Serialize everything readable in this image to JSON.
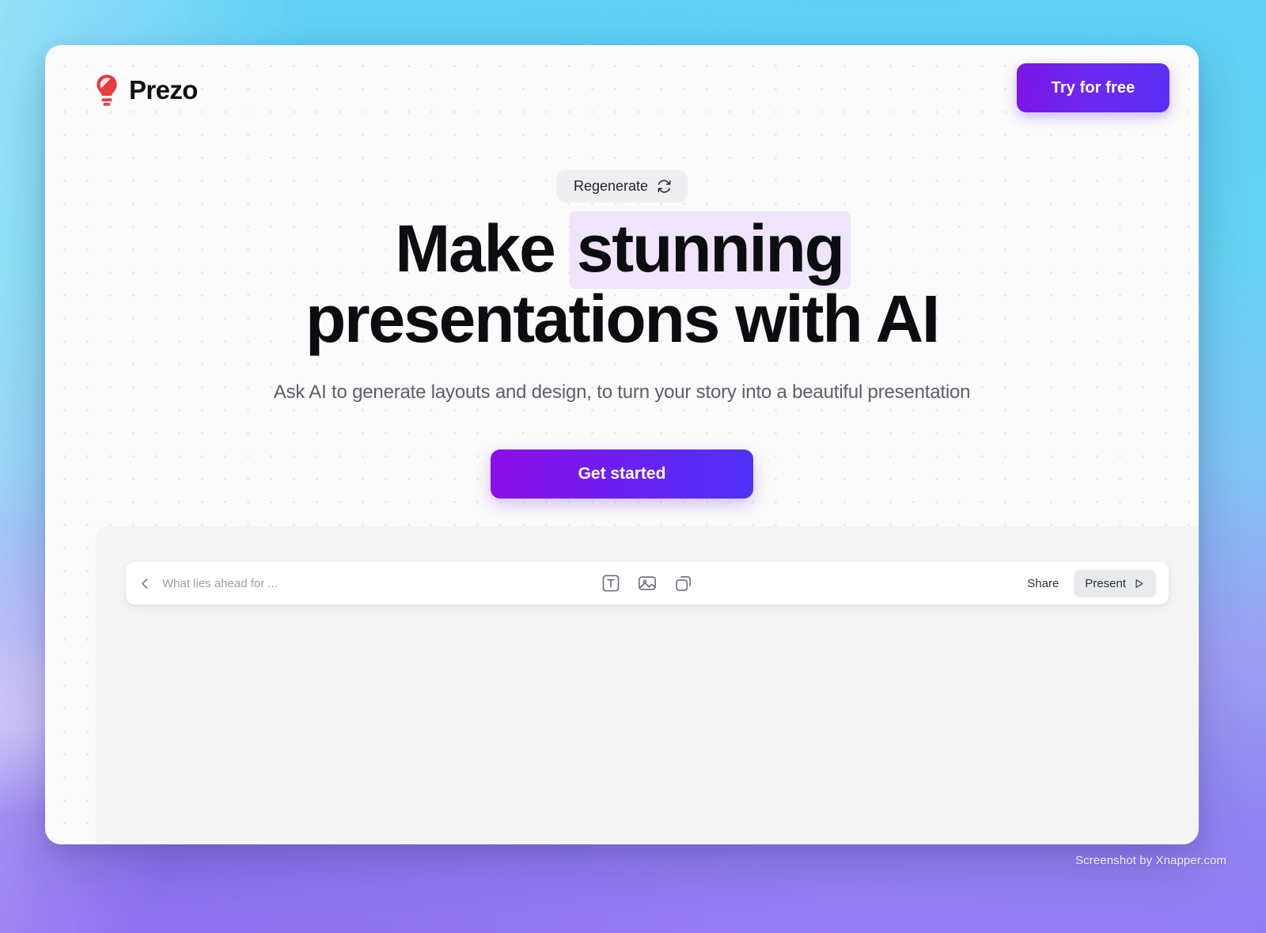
{
  "header": {
    "brand_name": "Prezo",
    "logo_icon": "lightbulb-icon",
    "logo_color": "#e8383f",
    "try_button_label": "Try for free"
  },
  "hero": {
    "regenerate_label": "Regenerate",
    "regenerate_icon": "refresh-cycle-icon",
    "headline_part1": "Make ",
    "headline_highlight": "stunning",
    "headline_part2": "presentations with AI",
    "highlight_color": "#f0e4fb",
    "subtitle": "Ask AI to generate layouts and design, to turn your story into a beautiful presentation",
    "cta_label": "Get started",
    "cta_gradient_from": "#8a0ee6",
    "cta_gradient_to": "#5132f7"
  },
  "editor": {
    "toolbar": {
      "back_icon": "chevron-left-icon",
      "document_title": "What lies ahead for ...",
      "tools": [
        {
          "name": "text-box-icon",
          "label": "Text"
        },
        {
          "name": "image-icon",
          "label": "Image"
        },
        {
          "name": "shapes-icon",
          "label": "Shape"
        }
      ],
      "share_label": "Share",
      "present_label": "Present",
      "present_icon": "play-triangle-icon"
    }
  },
  "watermark": {
    "text": "Screenshot by Xnapper.com"
  }
}
